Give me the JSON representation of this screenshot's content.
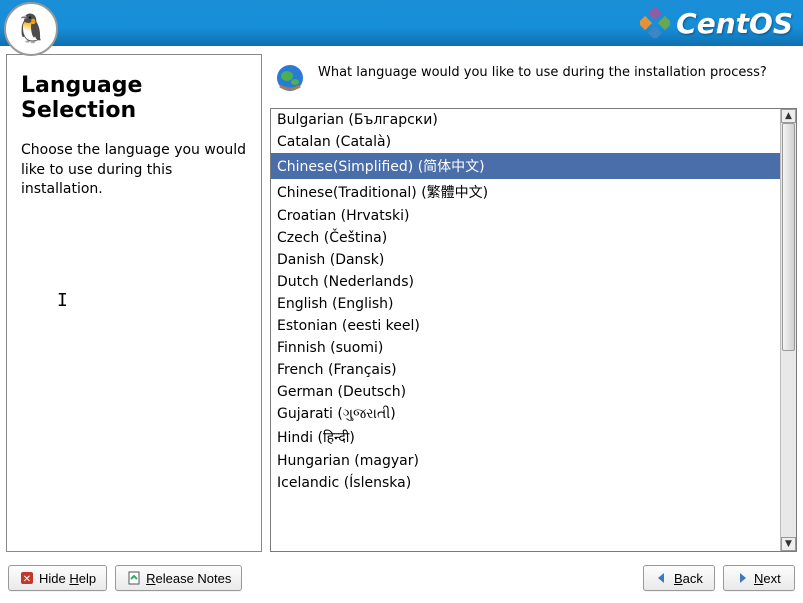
{
  "brand": {
    "text": "CentOS"
  },
  "side": {
    "title": "Language Selection",
    "text": "Choose the language you would like to use during this installation."
  },
  "prompt": "What language would you like to use during the installation process?",
  "languages": [
    {
      "label": "Bulgarian (Български)",
      "selected": false
    },
    {
      "label": "Catalan (Català)",
      "selected": false
    },
    {
      "label": "Chinese(Simplified) (简体中文)",
      "selected": true
    },
    {
      "label": "Chinese(Traditional) (繁體中文)",
      "selected": false
    },
    {
      "label": "Croatian (Hrvatski)",
      "selected": false
    },
    {
      "label": "Czech (Čeština)",
      "selected": false
    },
    {
      "label": "Danish (Dansk)",
      "selected": false
    },
    {
      "label": "Dutch (Nederlands)",
      "selected": false
    },
    {
      "label": "English (English)",
      "selected": false
    },
    {
      "label": "Estonian (eesti keel)",
      "selected": false
    },
    {
      "label": "Finnish (suomi)",
      "selected": false
    },
    {
      "label": "French (Français)",
      "selected": false
    },
    {
      "label": "German (Deutsch)",
      "selected": false
    },
    {
      "label": "Gujarati (ગુજરાતી)",
      "selected": false
    },
    {
      "label": "Hindi (हिन्दी)",
      "selected": false
    },
    {
      "label": "Hungarian (magyar)",
      "selected": false
    },
    {
      "label": "Icelandic (Íslenska)",
      "selected": false
    }
  ],
  "buttons": {
    "hide_help": "Hide Help",
    "release_notes": "Release Notes",
    "back": "Back",
    "next": "Next"
  }
}
